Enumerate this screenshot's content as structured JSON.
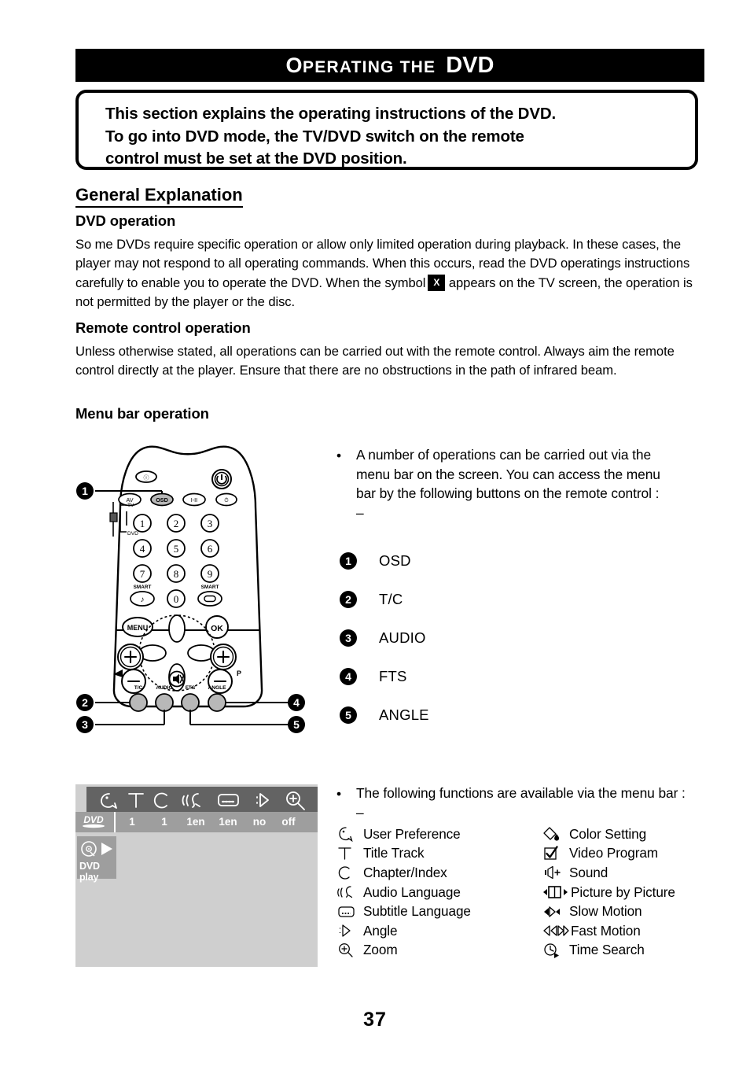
{
  "header": {
    "title_cap": "O",
    "title_small": "PERATING THE",
    "title_dvd": "DVD"
  },
  "intro": {
    "line1": "This section explains the operating instructions of the DVD.",
    "line2": "To go into DVD mode, the TV/DVD switch on the remote",
    "line3": "control must be set at the DVD position."
  },
  "sections": {
    "general_explanation": "General Explanation",
    "dvd_operation_heading": "DVD operation",
    "dvd_operation_body_a": "So me DVDs require specific operation or allow only limited operation during playback. In these cases, the player may not respond to all operating commands. When this occurs, read the DVD operatings instructions carefully to enable you to operate the DVD. When the symbol",
    "dvd_operation_symbol": "X",
    "dvd_operation_body_b": "appears on the TV screen, the operation is not permitted by the player or the disc.",
    "remote_control_heading": "Remote control operation",
    "remote_control_body": "Unless otherwise stated, all operations can be carried out with the remote control. Always aim the remote control directly at the player. Ensure that there are no obstructions in the path of infrared beam.",
    "menu_bar_heading": "Menu bar operation"
  },
  "menu_bar_intro": {
    "bullet": "•",
    "text": "A number of operations can be carried out via the menu bar on the screen. You can access the menu bar by the following buttons on the remote control : –"
  },
  "button_list": [
    {
      "num": "1",
      "label": "OSD"
    },
    {
      "num": "2",
      "label": "T/C"
    },
    {
      "num": "3",
      "label": "AUDIO"
    },
    {
      "num": "4",
      "label": "FTS"
    },
    {
      "num": "5",
      "label": "ANGLE"
    }
  ],
  "remote": {
    "callouts": [
      "1",
      "2",
      "3",
      "4",
      "5"
    ],
    "switch_top_label": "TV",
    "switch_bottom_label": "DVD",
    "top_buttons": [
      "AV",
      "OSD",
      "I-II",
      "⏱"
    ],
    "keypad": [
      "1",
      "2",
      "3",
      "4",
      "5",
      "6",
      "7",
      "8",
      "9",
      "0"
    ],
    "smart_label": "SMART",
    "menu_label": "MENU",
    "ok_label": "OK",
    "program_label": "P",
    "bottom_buttons": [
      "T/C",
      "AUDIO",
      "FTS",
      "ANGLE"
    ]
  },
  "tv_screen": {
    "disc_label": "DVD",
    "icons": [
      "user-preference-icon",
      "title-icon",
      "chapter-icon",
      "audio-language-icon",
      "subtitle-language-icon",
      "angle-icon",
      "zoom-icon"
    ],
    "values": [
      "1",
      "1",
      "1en",
      "1en",
      "no",
      "off"
    ],
    "status_text": "DVD play"
  },
  "functions_intro": {
    "bullet": "•",
    "text": "The following functions are available via the menu bar : –"
  },
  "functions_left": [
    {
      "icon": "user-preference-icon",
      "label": "User Preference"
    },
    {
      "icon": "title-track-icon",
      "label": "Title Track"
    },
    {
      "icon": "chapter-index-icon",
      "label": "Chapter/Index"
    },
    {
      "icon": "audio-language-icon",
      "label": "Audio Language"
    },
    {
      "icon": "subtitle-language-icon",
      "label": "Subtitle Language"
    },
    {
      "icon": "angle-icon",
      "label": "Angle"
    },
    {
      "icon": "zoom-icon",
      "label": "Zoom"
    }
  ],
  "functions_right": [
    {
      "icon": "color-setting-icon",
      "label": "Color Setting"
    },
    {
      "icon": "video-program-icon",
      "label": "Video Program"
    },
    {
      "icon": "sound-icon",
      "label": "Sound"
    },
    {
      "icon": "picture-by-picture-icon",
      "label": "Picture by Picture"
    },
    {
      "icon": "slow-motion-icon",
      "label": "Slow Motion"
    },
    {
      "icon": "fast-motion-icon",
      "label": "Fast Motion"
    },
    {
      "icon": "time-search-icon",
      "label": "Time Search"
    }
  ],
  "page_number": "37",
  "colors": {
    "banner_bg": "#000000",
    "tv_background": "#cfcfcf",
    "tv_icon_bar": "#636363",
    "tv_value_bar": "#9e9e9e"
  }
}
